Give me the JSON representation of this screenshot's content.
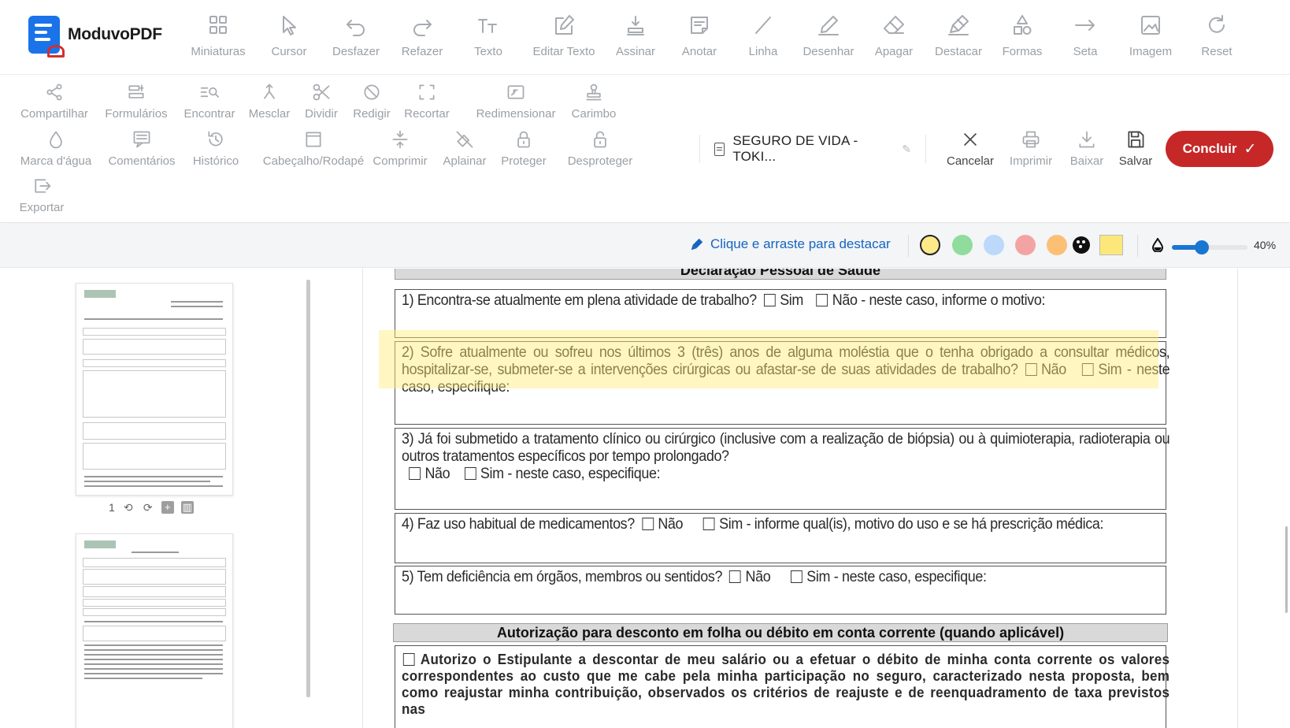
{
  "app": {
    "name": "ModuvoPDF"
  },
  "toolbar": {
    "row1": [
      {
        "id": "miniaturas",
        "label": "Miniaturas",
        "icon": "grid-icon"
      },
      {
        "id": "cursor",
        "label": "Cursor",
        "icon": "cursor-icon"
      },
      {
        "id": "desfazer",
        "label": "Desfazer",
        "icon": "undo-icon"
      },
      {
        "id": "refazer",
        "label": "Refazer",
        "icon": "redo-icon"
      },
      {
        "id": "texto",
        "label": "Texto",
        "icon": "text-icon"
      },
      {
        "id": "editar-texto",
        "label": "Editar Texto",
        "icon": "edit-icon"
      },
      {
        "id": "assinar",
        "label": "Assinar",
        "icon": "stamp-sign-icon"
      },
      {
        "id": "anotar",
        "label": "Anotar",
        "icon": "note-icon"
      },
      {
        "id": "linha",
        "label": "Linha",
        "icon": "line-icon"
      },
      {
        "id": "desenhar",
        "label": "Desenhar",
        "icon": "pen-icon"
      },
      {
        "id": "apagar",
        "label": "Apagar",
        "icon": "eraser-icon"
      },
      {
        "id": "destacar",
        "label": "Destacar",
        "icon": "highlighter-icon"
      },
      {
        "id": "formas",
        "label": "Formas",
        "icon": "shapes-icon"
      },
      {
        "id": "seta",
        "label": "Seta",
        "icon": "arrow-icon"
      },
      {
        "id": "imagem",
        "label": "Imagem",
        "icon": "image-icon"
      },
      {
        "id": "reset",
        "label": "Reset",
        "icon": "reset-icon"
      }
    ],
    "row2": [
      {
        "id": "compartilhar",
        "label": "Compartilhar",
        "icon": "share-icon"
      },
      {
        "id": "formularios",
        "label": "Formulários",
        "icon": "form-icon"
      },
      {
        "id": "encontrar",
        "label": "Encontrar",
        "icon": "find-icon"
      },
      {
        "id": "mesclar",
        "label": "Mesclar",
        "icon": "merge-icon"
      },
      {
        "id": "dividir",
        "label": "Dividir",
        "icon": "scissors-icon"
      },
      {
        "id": "redigir",
        "label": "Redigir",
        "icon": "redact-icon"
      },
      {
        "id": "recortar",
        "label": "Recortar",
        "icon": "crop-icon"
      },
      {
        "id": "redimensionar",
        "label": "Redimensionar",
        "icon": "resize-icon"
      },
      {
        "id": "carimbo",
        "label": "Carimbo",
        "icon": "stamp-icon"
      }
    ],
    "row3": [
      {
        "id": "marca-dagua",
        "label": "Marca d'água",
        "icon": "watermark-icon"
      },
      {
        "id": "comentarios",
        "label": "Comentários",
        "icon": "comment-icon"
      },
      {
        "id": "historico",
        "label": "Histórico",
        "icon": "history-icon"
      },
      {
        "id": "cabecalho",
        "label": "Cabeçalho/Rodapé",
        "icon": "header-footer-icon"
      },
      {
        "id": "comprimir",
        "label": "Comprimir",
        "icon": "compress-icon"
      },
      {
        "id": "aplainar",
        "label": "Aplainar",
        "icon": "flatten-icon"
      },
      {
        "id": "proteger",
        "label": "Proteger",
        "icon": "lock-icon"
      },
      {
        "id": "desproteger",
        "label": "Desproteger",
        "icon": "unlock-icon"
      }
    ],
    "row4": [
      {
        "id": "exportar",
        "label": "Exportar",
        "icon": "export-icon"
      }
    ],
    "document_name": "SEGURO DE VIDA - TOKI...",
    "actions": [
      {
        "id": "cancelar",
        "label": "Cancelar",
        "icon": "close-icon"
      },
      {
        "id": "imprimir",
        "label": "Imprimir",
        "icon": "print-icon"
      },
      {
        "id": "baixar",
        "label": "Baixar",
        "icon": "download-icon"
      },
      {
        "id": "salvar",
        "label": "Salvar",
        "icon": "save-icon"
      }
    ],
    "conclude_label": "Concluir"
  },
  "highlight_bar": {
    "hint": "Clique e arraste para destacar",
    "colors": [
      "#fde98a",
      "#8fdc9c",
      "#bcd8fb",
      "#f4a3a3",
      "#fbbf76"
    ],
    "selected_color": "#fde98a",
    "custom_color": "#fbe77a",
    "opacity_percent": 40,
    "opacity_label": "40%"
  },
  "sidebar": {
    "page_number": "1"
  },
  "document": {
    "section_title": "Declaração Pessoal de Saúde",
    "questions": [
      {
        "text": "1) Encontra-se atualmente em plena atividade de trabalho?",
        "opt1": "Sim",
        "opt2": "Não - neste caso, informe o motivo:"
      },
      {
        "text": "2) Sofre atualmente ou sofreu nos últimos 3 (três) anos de alguma moléstia que o tenha obrigado a consultar médicos, hospitalizar-se, submeter-se a intervenções cirúrgicas ou afastar-se de suas atividades de trabalho?",
        "opt1": "Não",
        "opt2": "Sim",
        "tail": "- neste caso, especifique:"
      },
      {
        "text": "3) Já foi submetido a tratamento clínico ou cirúrgico (inclusive com a realização de biópsia) ou à quimioterapia, radioterapia ou outros tratamentos específicos por tempo prolongado?",
        "opt1": "Não",
        "opt2": "Sim",
        "tail": "- neste caso, especifique:"
      },
      {
        "text": "4) Faz uso habitual de medicamentos?",
        "opt1": "Não",
        "opt2": "Sim",
        "tail": "- informe qual(is), motivo do uso e se há prescrição médica:"
      },
      {
        "text": "5) Tem deficiência em órgãos, membros ou sentidos?",
        "opt1": "Não",
        "opt2": "Sim",
        "tail": "- neste caso, especifique:"
      }
    ],
    "authorization_title": "Autorização para desconto em folha ou débito em conta corrente (quando aplicável)",
    "authorization_text": "Autorizo o Estipulante a descontar de meu salário ou a efetuar o débito de minha conta corrente os valores correspondentes ao custo que me cabe pela minha participação no seguro, caracterizado nesta proposta, bem como reajustar minha contribuição, observados os critérios de reajuste e de reenquadramento de taxa previstos nas"
  }
}
